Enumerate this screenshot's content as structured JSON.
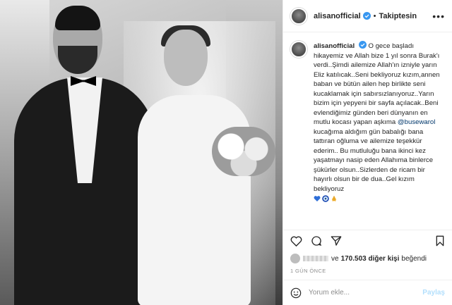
{
  "header": {
    "username": "alisanofficial",
    "separator": "•",
    "follow_state": "Takiptesin",
    "more_label": "•••"
  },
  "caption": {
    "username": "alisanofficial",
    "text_before_mention": "O gece başladı hikayemiz ve Allah bize 1 yıl sonra Burak'ı verdi..Şimdi ailemize Allah'ın izniyle yarın Eliz katılıcak..Seni bekliyoruz kızım,annen baban ve bütün ailen hep birlikte seni kucaklamak için sabırsızlanıyoruz..Yarın bizim için yepyeni bir sayfa açılacak..Beni evlendiğimiz günden beri dünyanın en mutlu kocası yapan aşkıma",
    "mention": "@busewarol",
    "text_after_mention": "kucağıma aldığım gün babalığı bana tattıran oğluma ve ailemize teşekkür ederim.. Bu mutluluğu bana ikinci kez yaşatmayı nasip eden Allahıma binlerce şükürler olsun..Sizlerden de ricam bir hayırlı olsun bir de dua..Gel kızım bekliyoruz",
    "emojis": [
      "blue-heart",
      "evil-eye",
      "folded-hands"
    ]
  },
  "likes": {
    "prefix": "ve",
    "count": "170.503 diğer kişi",
    "suffix": "beğendi"
  },
  "timestamp": "1 gün önce",
  "comment": {
    "placeholder": "Yorum ekle...",
    "post_label": "Paylaş"
  },
  "colors": {
    "accent": "#0095f6",
    "verified": "#3897f0",
    "post_disabled": "#b2dffc",
    "muted": "#8e8e8e",
    "text": "#262626"
  }
}
